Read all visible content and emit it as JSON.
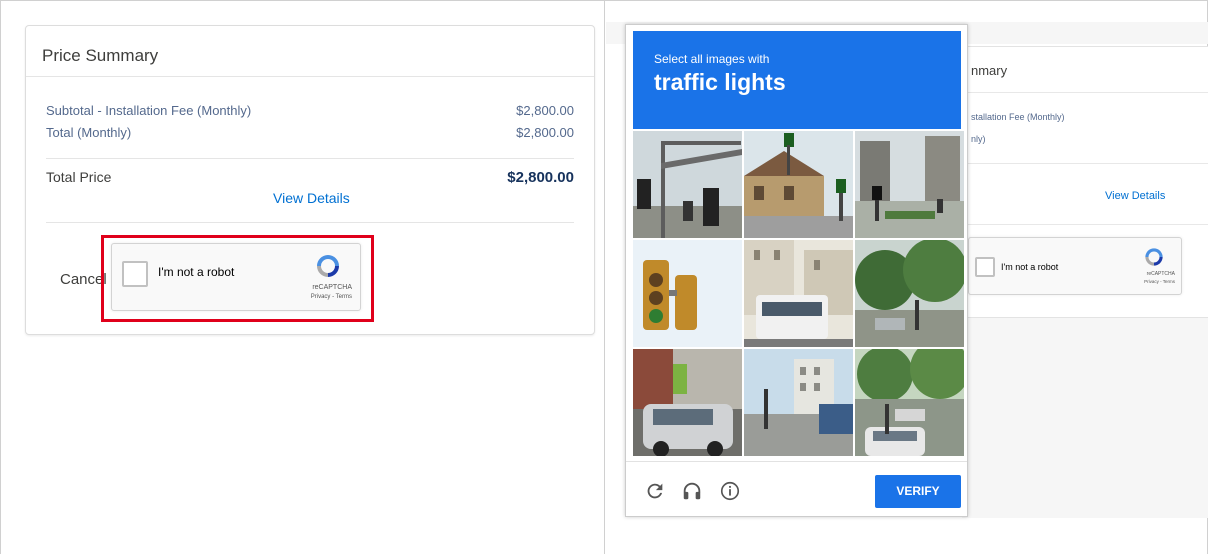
{
  "left_panel": {
    "card_title": "Price Summary",
    "rows": [
      {
        "label": "Subtotal - Installation Fee (Monthly)",
        "value": "$2,800.00"
      },
      {
        "label": "Total (Monthly)",
        "value": "$2,800.00"
      }
    ],
    "total_label": "Total Price",
    "total_value": "$2,800.00",
    "view_details": "View Details",
    "cancel": "Cancel",
    "recaptcha": {
      "label": "I'm not a robot",
      "brand": "reCAPTCHA",
      "terms": "Privacy - Terms"
    }
  },
  "right_panel": {
    "bg_title_fragment": "nmary",
    "bg_row1_fragment": "stallation Fee (Monthly)",
    "bg_row2_fragment": "nly)",
    "view_details": "View Details",
    "recaptcha": {
      "label": "I'm not a robot",
      "brand": "reCAPTCHA",
      "terms": "Privacy - Terms"
    },
    "challenge": {
      "instruction": "Select all images with",
      "target": "traffic lights",
      "verify_label": "VERIFY",
      "footer_icons": [
        "reload-icon",
        "audio-icon",
        "info-icon"
      ]
    }
  },
  "colors": {
    "highlight": "#e0001b",
    "captcha_blue": "#1a73e8",
    "link_blue": "#0070d2"
  }
}
